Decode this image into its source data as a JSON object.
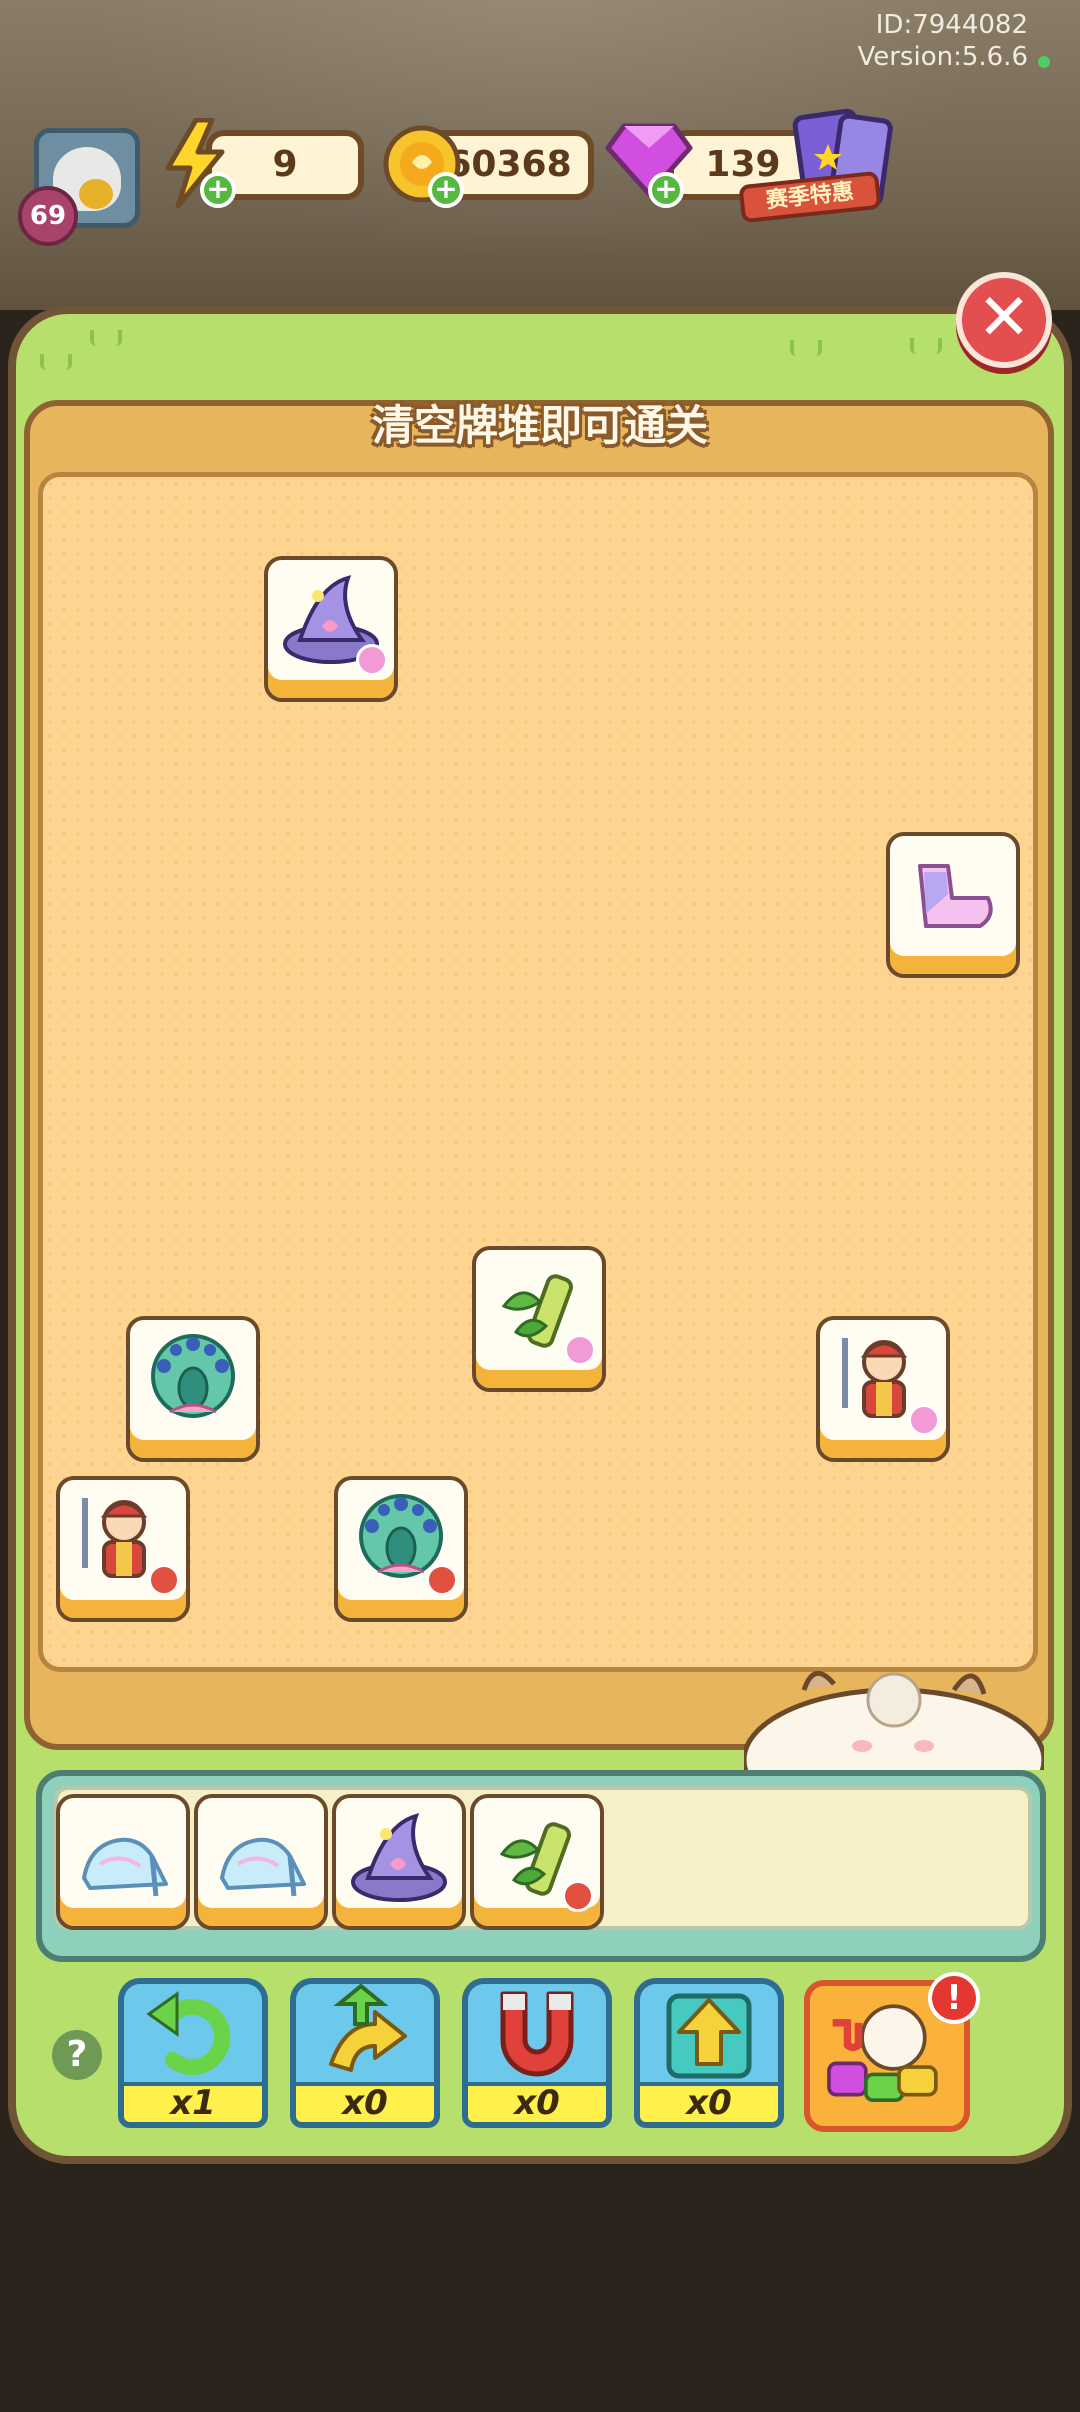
{
  "status": {
    "id_text": "ID:7944082",
    "version_text": "Version:5.6.6"
  },
  "player": {
    "level": "69"
  },
  "resources": {
    "energy": {
      "value": "9",
      "icon": "lightning-icon"
    },
    "coins": {
      "value": "60368",
      "icon": "coin-icon"
    },
    "gems": {
      "value": "139",
      "icon": "gem-icon"
    }
  },
  "promo": {
    "label": "赛季特惠"
  },
  "board": {
    "title": "清空牌堆即可通关"
  },
  "tools": [
    {
      "name": "undo",
      "count": "x1",
      "icon": "undo-arrow-icon"
    },
    {
      "name": "shuffle",
      "count": "x0",
      "icon": "shuffle-arrows-icon"
    },
    {
      "name": "magnet",
      "count": "x0",
      "icon": "magnet-icon"
    },
    {
      "name": "move-out",
      "count": "x0",
      "icon": "up-arrow-icon"
    }
  ],
  "colors": {
    "panel_green": "#b7df6b",
    "board_orange": "#fdd591",
    "tile_face": "#fffdf2",
    "tool_blue": "#6dc9ec",
    "count_yellow": "#fff04c"
  },
  "tiles_on_board": [
    "witch-hat",
    "pink-boot",
    "bamboo",
    "peacock",
    "knight",
    "knight",
    "peacock"
  ],
  "tray_tiles": [
    "glass-slipper",
    "glass-slipper",
    "witch-hat",
    "bamboo"
  ]
}
